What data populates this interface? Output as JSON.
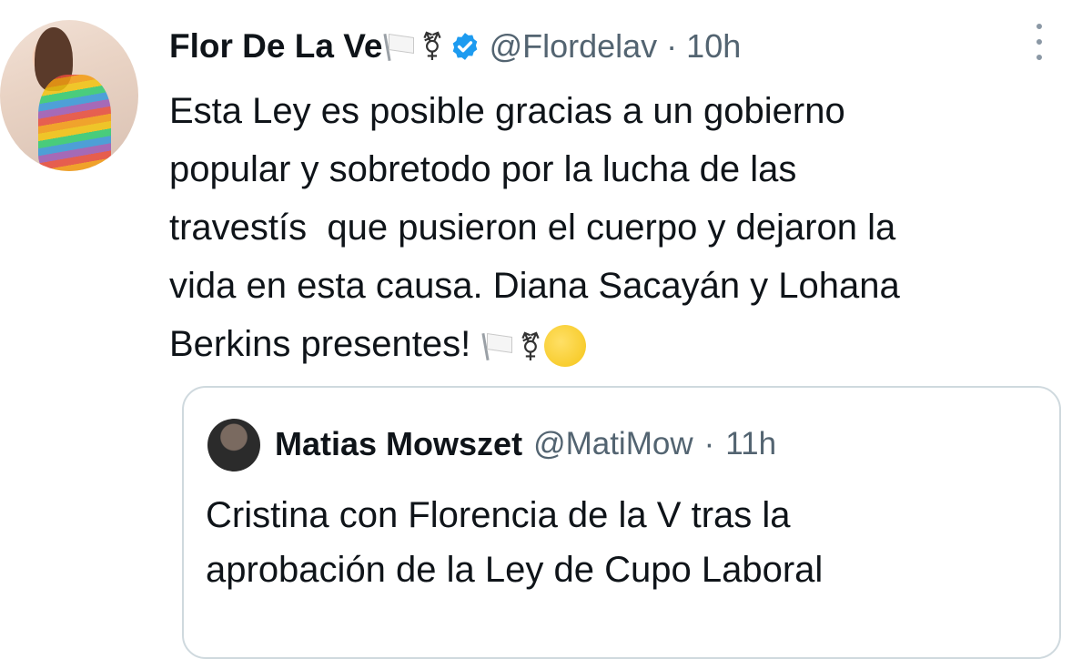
{
  "tweet": {
    "author_name": "Flor De La Ve",
    "author_handle": "@Flordelav",
    "separator": "·",
    "time": "10h",
    "trans_symbol": "⚧",
    "body_lines": [
      "Esta Ley es posible gracias a un gobierno",
      "popular y sobretodo por la lucha de las",
      "travestís  que pusieron el cuerpo y dejaron la",
      "vida en esta causa. Diana Sacayán y Lohana",
      "Berkins presentes!"
    ],
    "icons": {
      "avatar": "avatar-image",
      "flag": "white-flag-icon",
      "verified": "verified-badge-icon",
      "more": "more-options-icon",
      "fist": "raised-fist-icon"
    }
  },
  "quoted_tweet": {
    "author_name": "Matias Mowszet",
    "author_handle": "@MatiMow",
    "separator": "·",
    "time": "11h",
    "body_lines": [
      "Cristina con Florencia de la V tras la",
      "aprobación de la Ley de Cupo Laboral"
    ]
  },
  "colors": {
    "text": "#0f1419",
    "secondary": "#536471",
    "verified": "#1d9bf0",
    "border": "#cfd9de"
  }
}
